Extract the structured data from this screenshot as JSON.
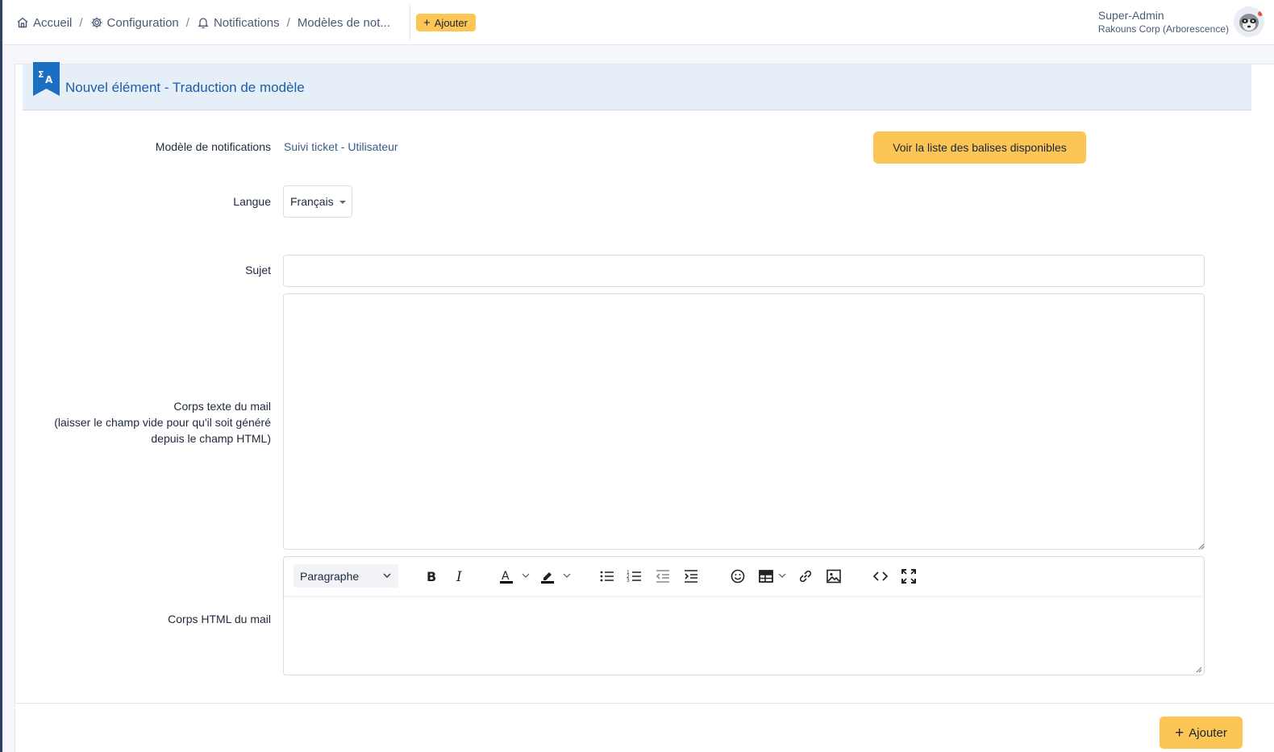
{
  "breadcrumb": {
    "items": [
      {
        "label": "Accueil",
        "icon": "home-icon"
      },
      {
        "label": "Configuration",
        "icon": "gear-icon"
      },
      {
        "label": "Notifications",
        "icon": "bell-icon"
      },
      {
        "label": "Modèles de not..."
      }
    ],
    "separator": "/"
  },
  "header": {
    "add_label": "Ajouter",
    "user_name": "Super-Admin",
    "user_entity": "Rakouns Corp (Arborescence)"
  },
  "card": {
    "title": "Nouvel élément - Traduction de modèle",
    "icon": "translate-icon"
  },
  "form": {
    "template_label": "Modèle de notifications",
    "template_value": "Suivi ticket - Utilisateur",
    "tags_button": "Voir la liste des balises disponibles",
    "language_label": "Langue",
    "language_value": "Français",
    "subject_label": "Sujet",
    "subject_value": "",
    "body_text_label_line1": "Corps texte du mail",
    "body_text_label_line2": "(laisser le champ vide pour qu'il soit généré",
    "body_text_label_line3": "depuis le champ HTML)",
    "body_text_value": "",
    "body_html_label": "Corps HTML du mail",
    "editor_block_format": "Paragraphe"
  },
  "footer": {
    "add_label": "Ajouter"
  },
  "colors": {
    "accent": "#fbc655",
    "header_bg": "#e6eef8",
    "title_blue": "#1b5fa8",
    "sidebar": "#2f3f64"
  }
}
